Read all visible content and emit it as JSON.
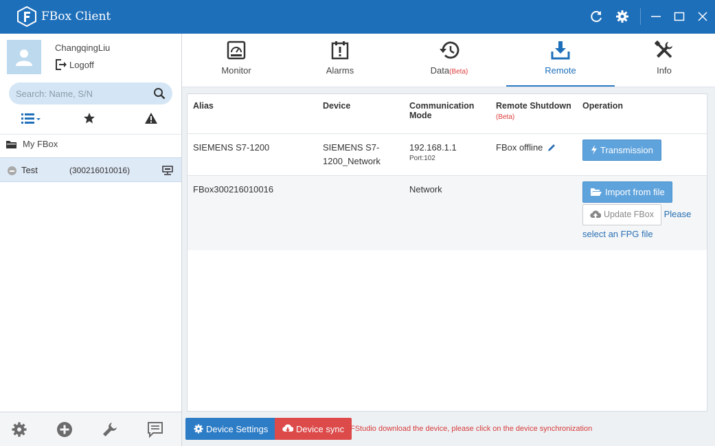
{
  "app": {
    "title": "FBox Client"
  },
  "user": {
    "name": "ChangqingLiu",
    "logoff_label": "Logoff"
  },
  "search": {
    "placeholder": "Search: Name, S/N"
  },
  "tree": {
    "root_label": "My FBox",
    "items": [
      {
        "name": "Test",
        "sn": "(300216010016)"
      }
    ]
  },
  "tabs": [
    {
      "label": "Monitor",
      "icon": "monitor-icon"
    },
    {
      "label": "Alarms",
      "icon": "alarm-icon"
    },
    {
      "label": "Data",
      "beta": "(Beta)",
      "icon": "history-icon"
    },
    {
      "label": "Remote",
      "icon": "download-icon",
      "active": true
    },
    {
      "label": "Info",
      "icon": "tools-icon"
    }
  ],
  "table": {
    "headers": {
      "alias": "Alias",
      "device": "Device",
      "comm": "Communication Mode",
      "shutdown": "Remote Shutdown",
      "shutdown_beta": "(Beta)",
      "operation": "Operation"
    },
    "rows": [
      {
        "alias": "SIEMENS S7-1200",
        "device": "SIEMENS S7-1200_Network",
        "comm": "192.168.1.1",
        "port": "Port:102",
        "shutdown": "FBox offline",
        "op_button": "Transmission"
      },
      {
        "alias": "FBox300216010016",
        "device": "",
        "comm": "Network",
        "import_button": "Import from file",
        "update_button": "Update FBox",
        "hint": "Please select an FPG file"
      }
    ]
  },
  "bottom": {
    "settings_button": "Device Settings",
    "sync_button": "Device sync",
    "sync_message": "FStudio download the device, please click on the device synchronization"
  },
  "colors": {
    "titlebar": "#1e6fba",
    "primary": "#2c7cc6",
    "danger": "#dc4a4a",
    "beta": "#e03b3b"
  }
}
